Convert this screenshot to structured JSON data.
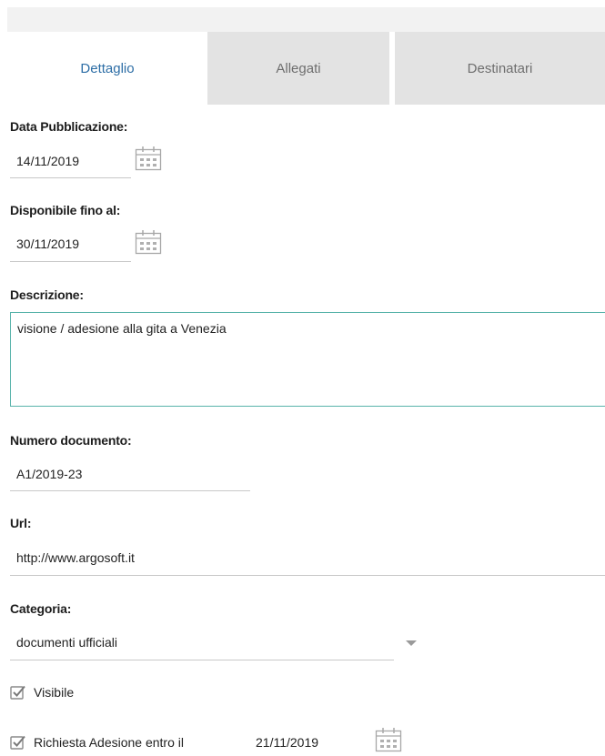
{
  "tabs": [
    {
      "label": "Dettaglio"
    },
    {
      "label": "Allegati"
    },
    {
      "label": "Destinatari"
    }
  ],
  "form": {
    "data_pubblicazione": {
      "label": "Data Pubblicazione:",
      "value": "14/11/2019"
    },
    "disponibile_fino": {
      "label": "Disponibile fino al:",
      "value": "30/11/2019"
    },
    "descrizione": {
      "label": "Descrizione:",
      "value": "visione / adesione alla gita a Venezia"
    },
    "numero_documento": {
      "label": "Numero documento:",
      "value": "A1/2019-23"
    },
    "url": {
      "label": "Url:",
      "value": "http://www.argosoft.it"
    },
    "categoria": {
      "label": "Categoria:",
      "value": "documenti ufficiali"
    },
    "visibile": {
      "label": "Visibile",
      "checked": true
    },
    "richiesta_adesione": {
      "label": "Richiesta Adesione entro il",
      "checked": true,
      "date": "21/11/2019"
    }
  },
  "colors": {
    "accent": "#2d6ea6",
    "focus_border": "#58b3aa",
    "tab_inactive_bg": "#e3e3e3"
  },
  "icons": {
    "calendar": "calendar-icon",
    "checkbox": "checkbox-checked-icon",
    "dropdown": "chevron-down-icon"
  }
}
